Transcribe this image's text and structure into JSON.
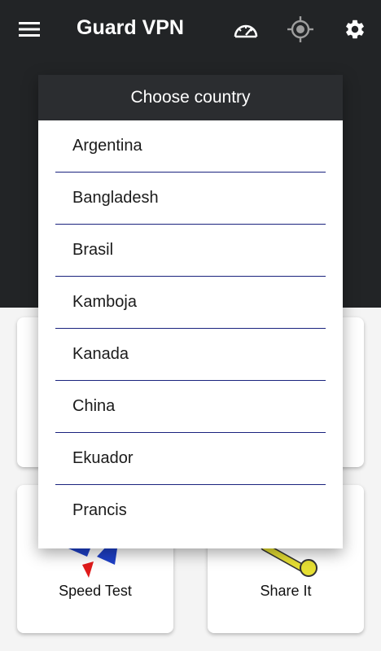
{
  "app": {
    "title": "Guard VPN"
  },
  "toolbar": {
    "menu_icon": "hamburger-menu-icon",
    "speed_icon": "speedometer-icon",
    "location_icon": "crosshair-icon",
    "settings_icon": "gear-icon"
  },
  "dialog": {
    "title": "Choose country",
    "countries": [
      "Argentina",
      "Bangladesh",
      "Brasil",
      "Kamboja",
      "Kanada",
      "China",
      "Ekuador",
      "Prancis"
    ]
  },
  "cards": {
    "speed_test_label": "Speed Test",
    "share_label": "Share It"
  },
  "colors": {
    "appbar": "#222426",
    "dialog_header": "#2b2d30",
    "divider": "#1a237e"
  }
}
